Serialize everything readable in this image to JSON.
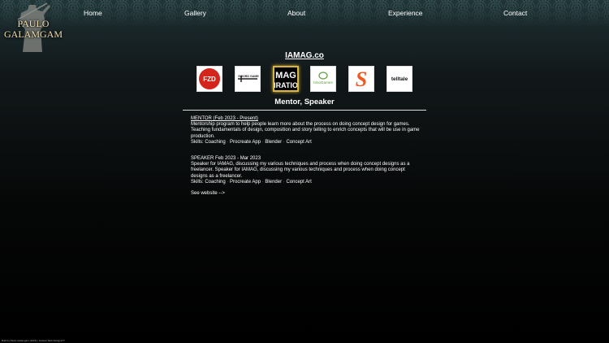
{
  "logo": {
    "line1": "PAULO",
    "line2": "GALAMGAM"
  },
  "nav": {
    "home": "Home",
    "gallery": "Gallery",
    "about": "About",
    "experience": "Experience",
    "contact": "Contact"
  },
  "section": {
    "title": "IAMAG.co",
    "role": "Mentor, Speaker"
  },
  "logos": {
    "fzd": "FZD",
    "sword": "SWORD GAME",
    "mag_top": "MAG",
    "mag_bottom": "IRATIO",
    "bino": "binoGames",
    "s_logo": "S",
    "telltale": "telltale"
  },
  "entries": {
    "mentor": {
      "heading": "MENTOR (Feb 2023 - Present)",
      "body": "Mentorship program to help people learn more about the process on doing concept design for games. Teaching fundamentals of design, composition and story telling to enrich concepts that will be use in game production.",
      "skills_label": "Skills:",
      "skills": [
        "Coaching",
        "Procreate App",
        "Blender",
        "Concept Art"
      ]
    },
    "speaker": {
      "heading": "SPEAKER Feb 2023 - Mar 2023",
      "body": "Speaker for IAMAG, discussing my various techniques and process when doing concept designs as a freelancer. Speaker for IAMAG, discussing my various techniques and process when doing concept designs as a freelancer.",
      "skills_label": "Skills:",
      "skills": [
        "Coaching",
        "Procreate App",
        "Blender",
        "Concept Art"
      ]
    }
  },
  "see_website": "See website -->",
  "footer": "Built by Paulo Galamgam (2023) | Icebear Web Designs??",
  "colors": {
    "accent_gold": "#d8b542",
    "logo_text": "#f1dfb0",
    "fzd_red": "#d3251c",
    "orange": "#f05a22"
  }
}
